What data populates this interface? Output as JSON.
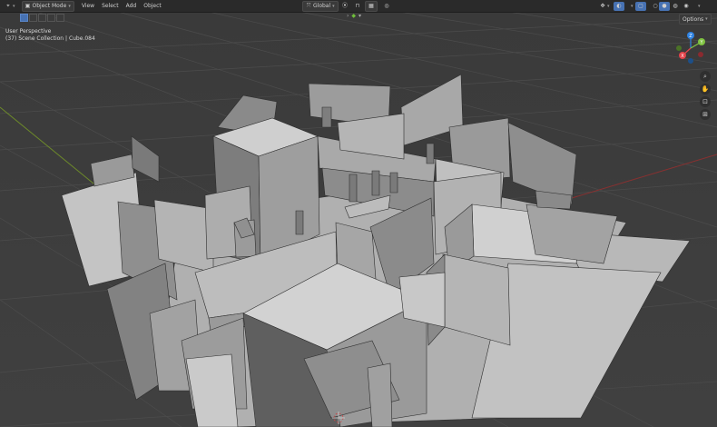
{
  "header": {
    "editor_icon": "3d-viewport-icon",
    "mode_label": "Object Mode",
    "menus": [
      "View",
      "Select",
      "Add",
      "Object"
    ],
    "orientation_label": "Global",
    "options_label": "Options"
  },
  "overlay": {
    "line1": "User Perspective",
    "line2": "(37) Scene Collection | Cube.084"
  },
  "gizmo": {
    "axis_x": "X",
    "axis_y": "Y",
    "axis_z": "Z",
    "colors": {
      "x": "#e2434b",
      "y": "#80c342",
      "z": "#2f83e2"
    }
  },
  "icons": [
    "zoom-icon",
    "hand-pan-icon",
    "camera-icon",
    "grid-icon"
  ],
  "colors": {
    "background": "#3d3d3d",
    "grid": "#4a4a4a",
    "x_axis_line": "#7a2a2a",
    "y_axis_line": "#5e7a22",
    "header": "#2a2a2a",
    "accent": "#4772b3"
  }
}
